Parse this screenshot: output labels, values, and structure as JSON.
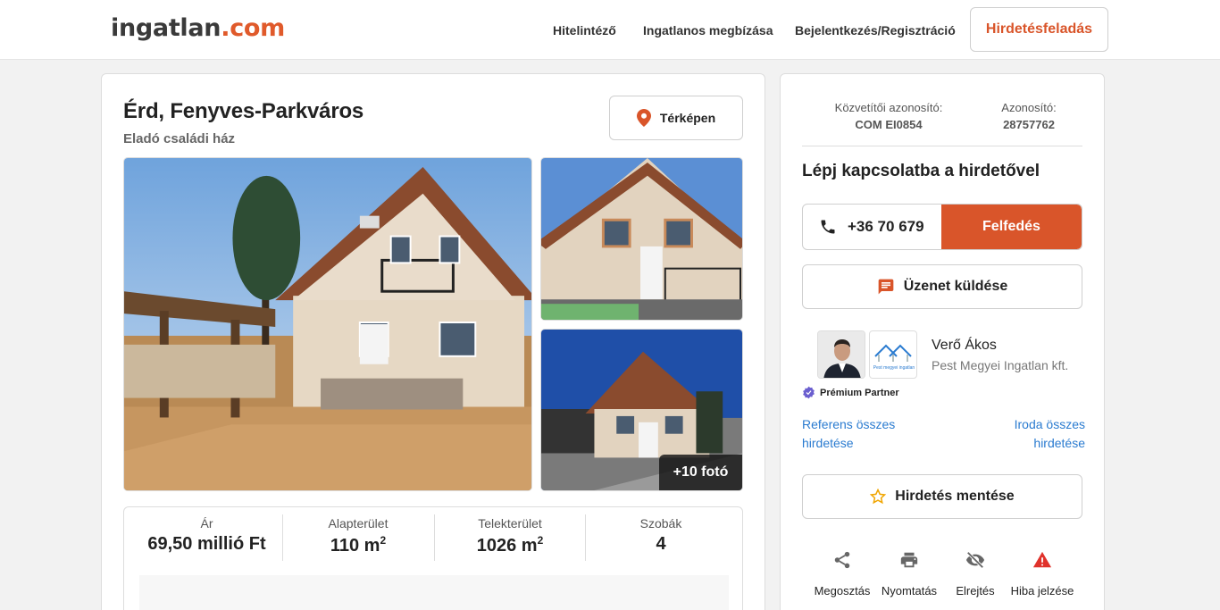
{
  "header": {
    "logo_main": "ingatlan",
    "logo_tld": ".com",
    "nav": [
      "Hitelintéző",
      "Ingatlanos megbízása",
      "Bejelentkezés/Regisztráció"
    ],
    "post_button": "Hirdetésfeladás",
    "accent_color": "#d9552a"
  },
  "listing": {
    "title": "Érd, Fenyves-Parkváros",
    "subtitle": "Eladó családi ház",
    "map_button": "Térképen",
    "more_photos": "+10 fotó",
    "stats": [
      {
        "label": "Ár",
        "value": "69,50 millió Ft",
        "sup": ""
      },
      {
        "label": "Alapterület",
        "value": "110 m",
        "sup": "2"
      },
      {
        "label": "Telekterület",
        "value": "1026 m",
        "sup": "2"
      },
      {
        "label": "Szobák",
        "value": "4",
        "sup": ""
      }
    ]
  },
  "sidebar": {
    "broker_id_label": "Közvetítői azonosító:",
    "broker_id_value": "COM EI0854",
    "id_label": "Azonosító:",
    "id_value": "28757762",
    "contact_heading": "Lépj kapcsolatba a hirdetővel",
    "phone": "+36 70 679",
    "reveal_button": "Felfedés",
    "message_button": "Üzenet küldése",
    "agent_name": "Verő Ákos",
    "agent_office": "Pest Megyei Ingatlan kft.",
    "agency_logo_text": "Pest megyei ingatlan",
    "premium_label": "Prémium Partner",
    "link_agent_ads": "Referens összes hirdetése",
    "link_office_ads": "Iroda összes hirdetése",
    "save_button": "Hirdetés mentése",
    "actions": [
      {
        "label": "Megosztás",
        "icon": "share-icon"
      },
      {
        "label": "Nyomtatás",
        "icon": "print-icon"
      },
      {
        "label": "Elrejtés",
        "icon": "hide-icon"
      },
      {
        "label": "Hiba jelzése",
        "icon": "warning-icon"
      }
    ]
  }
}
